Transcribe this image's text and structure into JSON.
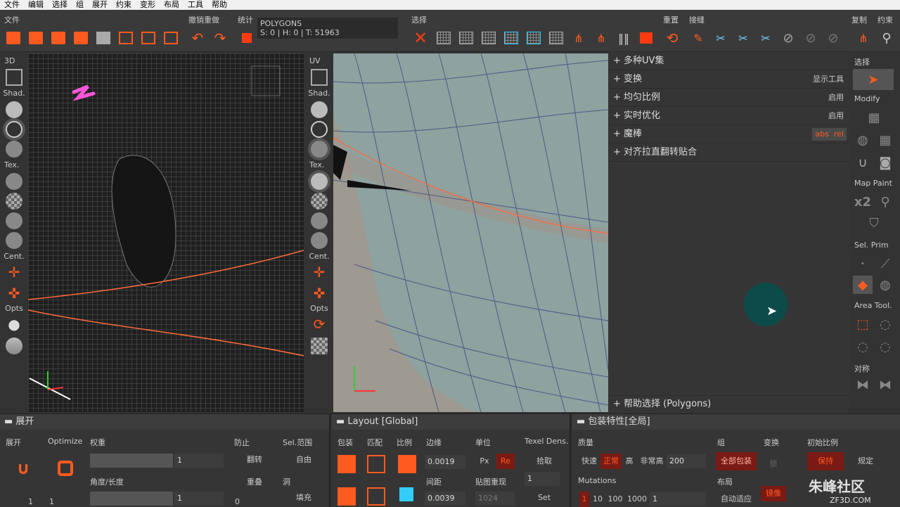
{
  "menu": [
    "文件",
    "编辑",
    "选择",
    "组",
    "展开",
    "约束",
    "变形",
    "布局",
    "工具",
    "帮助"
  ],
  "toolbar": {
    "file": "文件",
    "undo_redo": "撤销重做",
    "stats": "统计",
    "select": "选择",
    "reset": "重置",
    "stitch": "接缝",
    "copy": "复制",
    "constraint": "约束"
  },
  "poly_stats": {
    "mode": "POLYGONS",
    "counts": "S: 0 | H: 0 | T: 51963"
  },
  "left3d": {
    "title": "3D",
    "shad": "Shad.",
    "tex": "Tex.",
    "cent": "Cent.",
    "opts": "Opts"
  },
  "leftuv": {
    "title": "UV",
    "shad": "Shad.",
    "tex": "Tex.",
    "cent": "Cent.",
    "opts": "Opts"
  },
  "panel": {
    "rows": [
      {
        "label": "多种UV集",
        "right": ""
      },
      {
        "label": "变换",
        "right": "显示工具"
      },
      {
        "label": "均匀比例",
        "right": "启用"
      },
      {
        "label": "实时优化",
        "right": "启用"
      },
      {
        "label": "魔棒",
        "right": ""
      },
      {
        "label": "对齐拉直翻转贴合",
        "right": ""
      }
    ],
    "abs": "abs",
    "rel": "rel",
    "help": "帮助选择 (Polygons)"
  },
  "rightside": {
    "select": "选择",
    "modify": "Modify",
    "map_paint": "Map Paint",
    "x2": "x2",
    "sel_prim": "Sel. Prim",
    "area_tool": "Area Tool.",
    "symmetry": "对称"
  },
  "unfold": {
    "title": "展开",
    "col_unfold": "展开",
    "col_optimize": "Optimize",
    "col_weight": "权重",
    "weight_value": "1",
    "col_prevent": "防止",
    "col_selrange": "Sel.范围",
    "flip": "翻转",
    "free": "自由",
    "angle_len": "角度/长度",
    "angle_value": "1",
    "overlap": "重叠",
    "holes": "洞",
    "fill": "填充",
    "n1": "1",
    "n2": "1",
    "n3": "0"
  },
  "layout": {
    "title": "Layout [Global]",
    "pack": "包装",
    "match": "匹配",
    "scale": "比例",
    "margin": "边缘",
    "margin_val": "0.0019",
    "spacing": "间距",
    "spacing_val": "0.0039",
    "unit": "单位",
    "px": "Px",
    "re": "Re",
    "texel": "Texel Dens.",
    "pick": "拾取",
    "map_reproduce": "贴图重现",
    "map_val": "1",
    "res_val": "1024",
    "set": "Set"
  },
  "packprops": {
    "title": "包装特性[全局]",
    "quality": "质量",
    "fast": "快速",
    "normal": "正常",
    "high": "高",
    "very_high": "非常高",
    "value": "200",
    "group": "组",
    "all_pack": "全部包装",
    "transform": "变换",
    "lock": "锁",
    "init_scale": "初始比例",
    "keep": "保持",
    "rule": "规定",
    "mutations": "Mutations",
    "m_vals": [
      "1",
      "10",
      "100",
      "1000",
      "1"
    ],
    "layout": "布局",
    "auto_fit": "自动适应",
    "mirror": "镜像"
  },
  "watermark": "朱峰社区",
  "watermark_url": "ZF3D.COM"
}
